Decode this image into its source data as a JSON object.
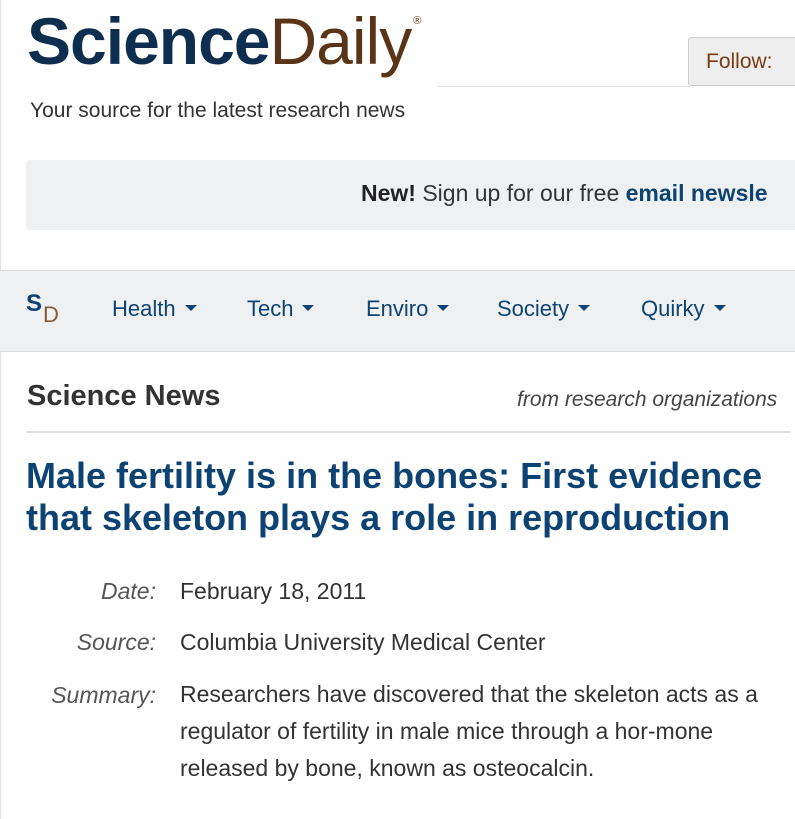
{
  "header": {
    "logo_science": "Science",
    "logo_daily": "Daily",
    "logo_reg": "®",
    "tagline": "Your source for the latest research news",
    "follow_label": "Follow:"
  },
  "signup": {
    "new_label": "New!",
    "text": " Sign up for our free ",
    "link_text": "email newsle"
  },
  "nav": {
    "logo_s": "S",
    "logo_d": "D",
    "items": [
      {
        "label": "Health"
      },
      {
        "label": "Tech"
      },
      {
        "label": "Enviro"
      },
      {
        "label": "Society"
      },
      {
        "label": "Quirky"
      }
    ]
  },
  "section": {
    "title": "Science News",
    "subtitle": "from research organizations"
  },
  "article": {
    "headline": "Male fertility is in the bones: First evidence that skeleton plays a role in reproduction",
    "date_label": "Date:",
    "date": "February 18, 2011",
    "source_label": "Source:",
    "source": "Columbia University Medical Center",
    "summary_label": "Summary:",
    "summary": "Researchers have discovered that the skeleton acts as a regulator of fertility in male mice through a hor-mone released by bone, known as osteocalcin."
  },
  "colors": {
    "brand_navy": "#0d2e4f",
    "brand_brown": "#5a3416",
    "link_blue": "#0d4373",
    "banner_bg": "#eef0f2"
  }
}
